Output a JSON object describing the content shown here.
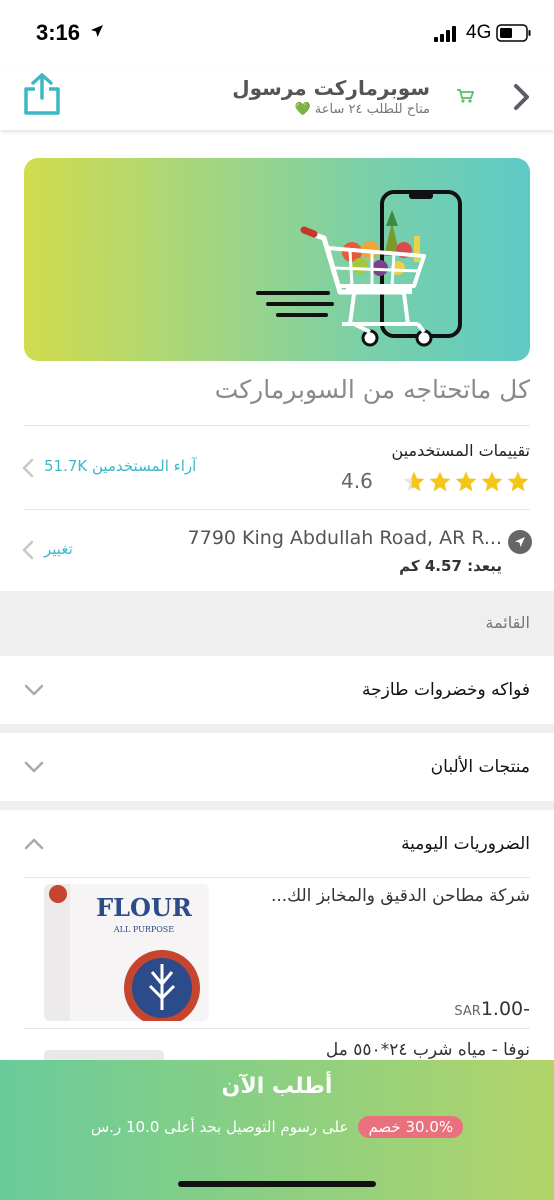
{
  "status_bar": {
    "time": "3:16",
    "network": "4G"
  },
  "header": {
    "store_name": "سوبرماركت مرسول",
    "availability": "متاح للطلب ٢٤ ساعة 💚",
    "share_icon": "share-icon",
    "back_icon": "chevron-right-icon"
  },
  "store": {
    "tagline": "كل ماتحتاجه من السوبرماركت",
    "ratings_title": "تقييمات المستخدمين",
    "rating": "4.6",
    "rating_stars": 4.6,
    "reviews_link": "آراء المستخدمين 51.7K",
    "address": "7790 King Abdullah Road, AR R...",
    "distance": "يبعد: 4.57 كم",
    "change_label": "تغيير"
  },
  "menu": {
    "title": "القائمة",
    "categories": [
      {
        "label": "فواكه وخضروات طازجة",
        "expanded": false
      },
      {
        "label": "منتجات الألبان",
        "expanded": false
      },
      {
        "label": "الضروريات اليومية",
        "expanded": true
      }
    ],
    "products": [
      {
        "name": "شركة مطاحن الدقيق والمخابز الك...",
        "image_text": "FLOUR",
        "image_subtext": "ALL PURPOSE",
        "price": "1.00-",
        "currency": "SAR"
      },
      {
        "name": "نوفا - مياه شرب ٢٤*٥٥٠ مل"
      }
    ]
  },
  "order_bar": {
    "button_label": "أطلب الآن",
    "discount_badge": "30.0% خصم",
    "discount_text": "على رسوم التوصيل بحد أعلى 10.0 ر.س"
  },
  "colors": {
    "accent": "#3cb8c5",
    "star": "#f5c518",
    "order_bar_start": "#6acb9a",
    "order_bar_end": "#b2d46a",
    "badge": "#e9717e"
  }
}
